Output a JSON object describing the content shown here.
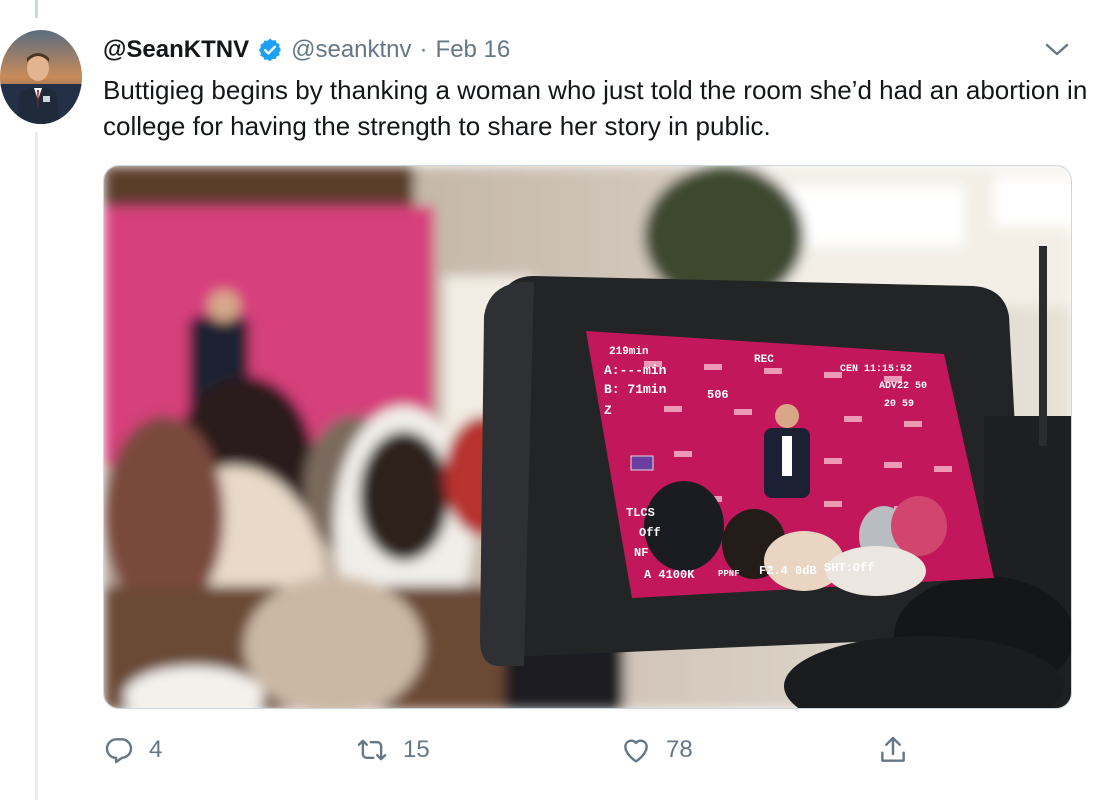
{
  "tweet": {
    "display_name": "@SeanKTNV",
    "handle": "@seanktnv",
    "separator": "·",
    "date": "Feb 16",
    "text": "Buttigieg begins by thanking a woman who just told the room she’d had an abortion in college for having the strength to share her story in public.",
    "verified": true
  },
  "media": {
    "camera_screen": {
      "rec": "REC",
      "top_left": "219min",
      "a_line": "A:---min",
      "b_line": "B: 71min",
      "z_line": "Z",
      "center_value": "506",
      "right_top": "CEN 11:15:52",
      "right_mid": "ADV22 50",
      "right_mid2": "20 59",
      "tlcs": "TLCS",
      "off1": "Off",
      "nf": "NF",
      "bottom": "A 4100K",
      "ppnf": "PPNF",
      "iris_gain": "F2.4 0dB",
      "shutter": "SHT:Off"
    }
  },
  "actions": {
    "reply_count": "4",
    "retweet_count": "15",
    "like_count": "78"
  },
  "colors": {
    "verified": "#1da1f2",
    "muted": "#657786",
    "backdrop": "#d81b60"
  }
}
